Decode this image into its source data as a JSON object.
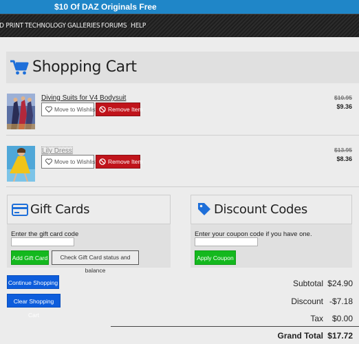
{
  "promo": {
    "text": "$10 Of DAZ Originals Free"
  },
  "nav": {
    "items": [
      "D PRINT",
      "TECHNOLOGY",
      "GALLERIES",
      "FORUMS",
      "HELP"
    ]
  },
  "cart": {
    "title": "Shopping Cart",
    "icon": "shopping-cart-icon",
    "items": [
      {
        "name": "Diving Suits for V4 Bodysuit",
        "wishlist_label": "Move to Wishlist",
        "remove_label": "Remove Item",
        "price_original": "$10.95",
        "price_sale": "$9.36"
      },
      {
        "name": "Lily Dress",
        "wishlist_label": "Move to Wishlist",
        "remove_label": "Remove Item",
        "price_original": "$13.95",
        "price_sale": "$8.36"
      }
    ]
  },
  "gift_cards": {
    "title": "Gift Cards",
    "icon": "credit-card-icon",
    "label": "Enter the gift card code",
    "input_value": "",
    "add_label": "Add Gift Card",
    "check_label": "Check Gift Card status and balance"
  },
  "discount": {
    "title": "Discount Codes",
    "icon": "tag-icon",
    "label": "Enter your coupon code if you have one.",
    "input_value": "",
    "apply_label": "Apply Coupon"
  },
  "actions": {
    "continue_label": "Continue Shopping",
    "clear_label": "Clear Shopping Cart"
  },
  "totals": {
    "subtotal_label": "Subtotal",
    "subtotal_value": "$24.90",
    "discount_label": "Discount",
    "discount_value": "-$7.18",
    "tax_label": "Tax",
    "tax_value": "$0.00",
    "grand_label": "Grand Total",
    "grand_value": "$17.72"
  },
  "colors": {
    "promo": "#1f86c8",
    "cart_icon": "#1e6fd9",
    "remove": "#c0141b",
    "green": "#14b81e",
    "blue": "#0d5ddc"
  }
}
